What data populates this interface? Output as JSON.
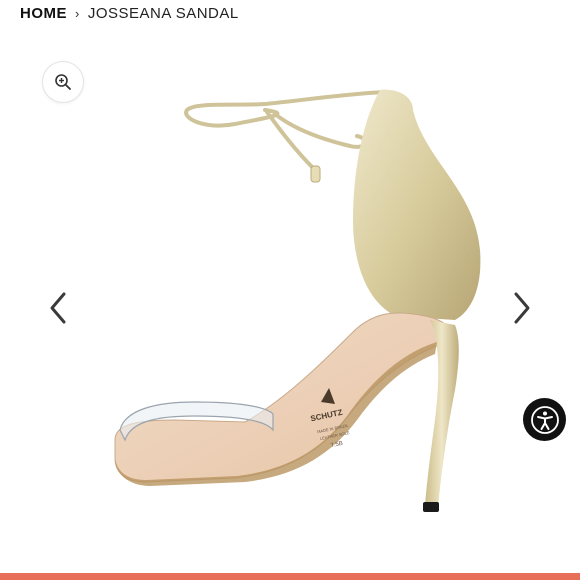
{
  "breadcrumb": {
    "home": "HOME",
    "separator": "›",
    "current": "JOSSEANA SANDAL"
  },
  "product_image": {
    "brand_imprint": "SCHUTZ",
    "insole_text": [
      "MADE IN BRAZIL",
      "LEATHER SOLE",
      "7.5B"
    ]
  },
  "icons": {
    "zoom": "zoom-in-icon",
    "prev": "chevron-left-icon",
    "next": "chevron-right-icon",
    "accessibility": "accessibility-icon"
  },
  "colors": {
    "text": "#111111",
    "arrow": "#333333",
    "accessibility_bg": "#111111",
    "bottom_bar": "#e8705a",
    "sandal_gold": "#d9cfa6"
  }
}
